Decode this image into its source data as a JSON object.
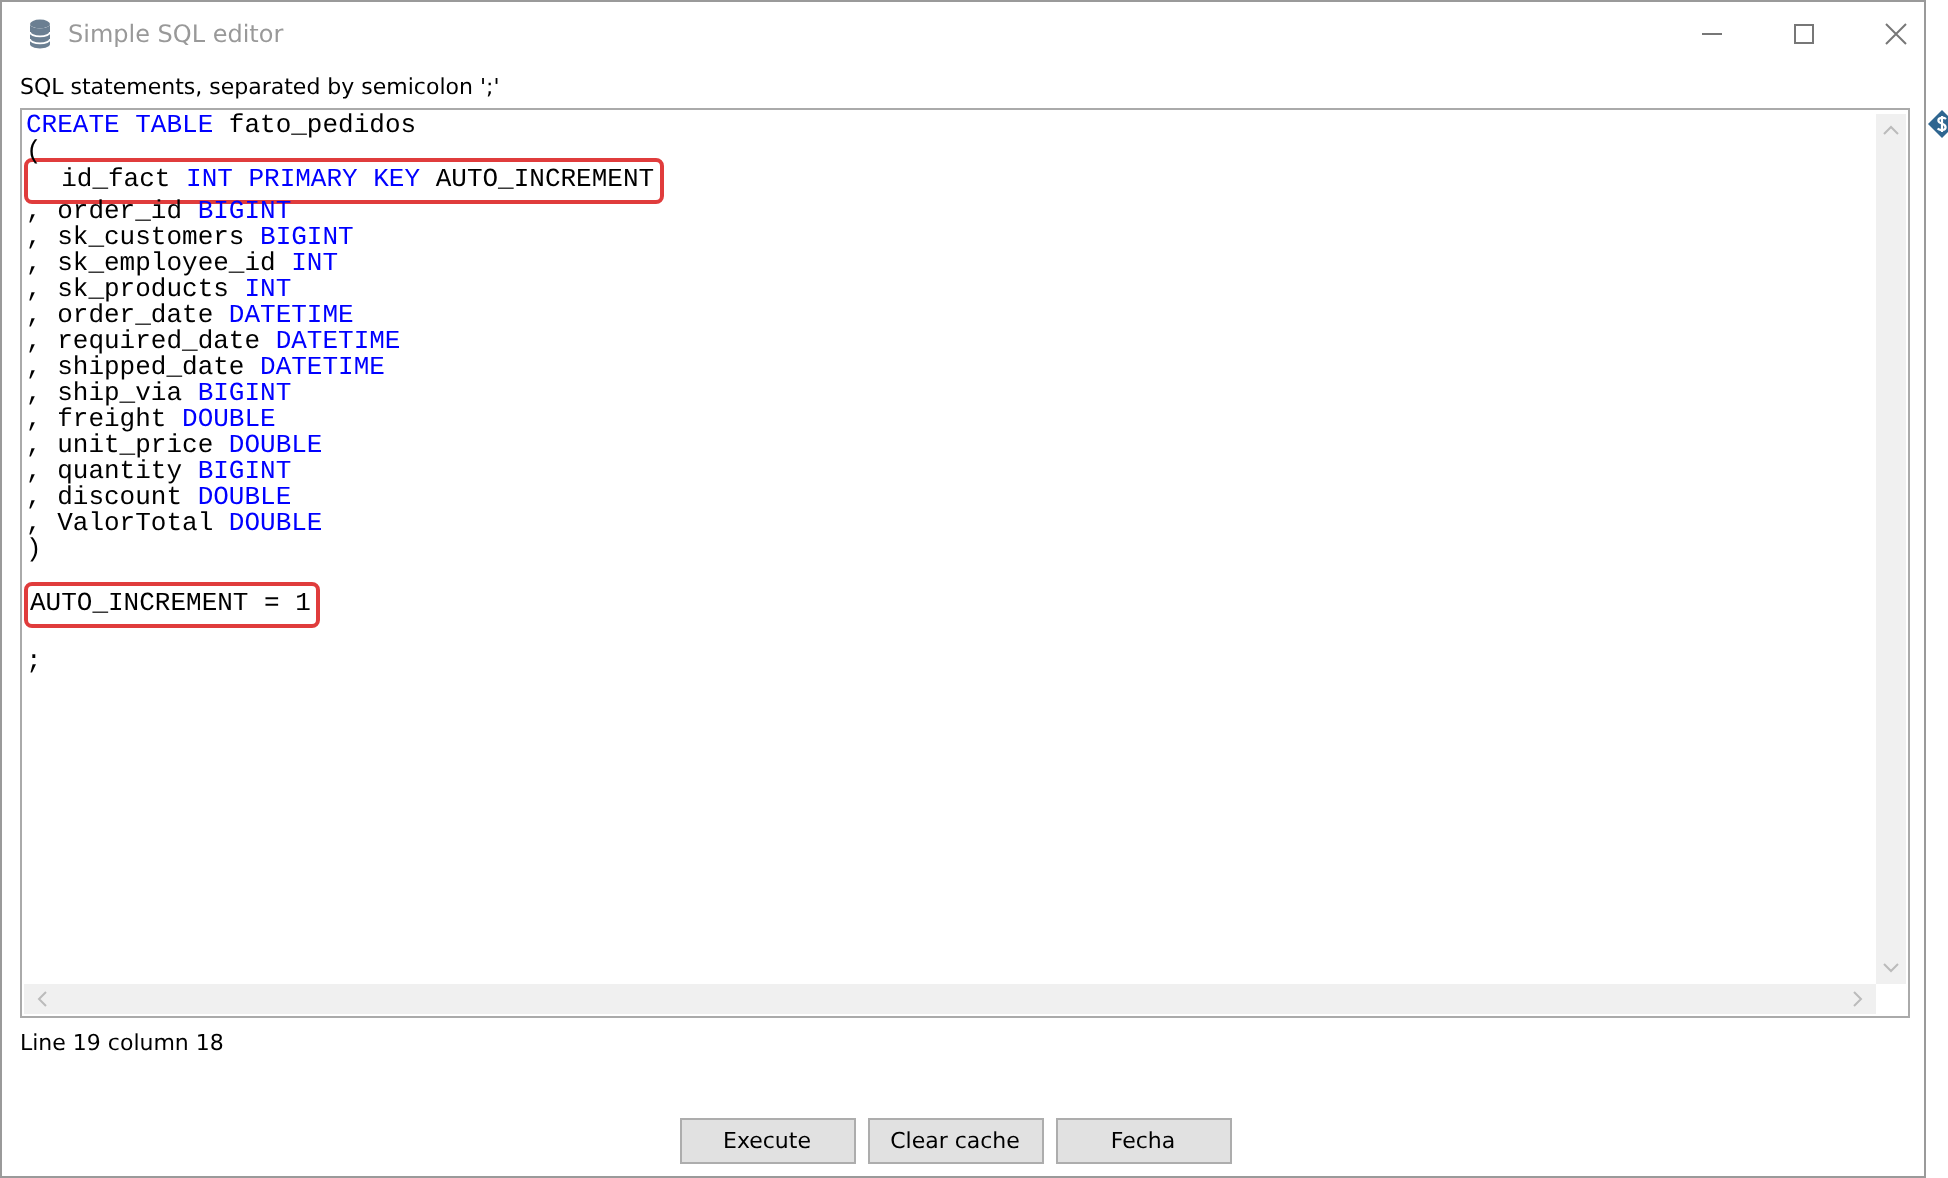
{
  "window": {
    "title": "Simple SQL editor"
  },
  "prompt": "SQL statements, separated by semicolon ';'",
  "editor": {
    "lines": [
      {
        "tokens": [
          {
            "text": "CREATE TABLE",
            "kind": "keyword"
          },
          {
            "text": " fato_pedidos",
            "kind": "plain"
          }
        ],
        "highlighted": false
      },
      {
        "tokens": [
          {
            "text": "(",
            "kind": "plain"
          }
        ],
        "highlighted": false
      },
      {
        "tokens": [
          {
            "text": "  id_fact ",
            "kind": "plain"
          },
          {
            "text": "INT PRIMARY KEY",
            "kind": "keyword"
          },
          {
            "text": " AUTO_INCREMENT",
            "kind": "plain"
          }
        ],
        "highlighted": true
      },
      {
        "tokens": [
          {
            "text": ", order_id ",
            "kind": "plain"
          },
          {
            "text": "BIGINT",
            "kind": "keyword"
          }
        ],
        "highlighted": false
      },
      {
        "tokens": [
          {
            "text": ", sk_customers ",
            "kind": "plain"
          },
          {
            "text": "BIGINT",
            "kind": "keyword"
          }
        ],
        "highlighted": false
      },
      {
        "tokens": [
          {
            "text": ", sk_employee_id ",
            "kind": "plain"
          },
          {
            "text": "INT",
            "kind": "keyword"
          }
        ],
        "highlighted": false
      },
      {
        "tokens": [
          {
            "text": ", sk_products ",
            "kind": "plain"
          },
          {
            "text": "INT",
            "kind": "keyword"
          }
        ],
        "highlighted": false
      },
      {
        "tokens": [
          {
            "text": ", order_date ",
            "kind": "plain"
          },
          {
            "text": "DATETIME",
            "kind": "keyword"
          }
        ],
        "highlighted": false
      },
      {
        "tokens": [
          {
            "text": ", required_date ",
            "kind": "plain"
          },
          {
            "text": "DATETIME",
            "kind": "keyword"
          }
        ],
        "highlighted": false
      },
      {
        "tokens": [
          {
            "text": ", shipped_date ",
            "kind": "plain"
          },
          {
            "text": "DATETIME",
            "kind": "keyword"
          }
        ],
        "highlighted": false
      },
      {
        "tokens": [
          {
            "text": ", ship_via ",
            "kind": "plain"
          },
          {
            "text": "BIGINT",
            "kind": "keyword"
          }
        ],
        "highlighted": false
      },
      {
        "tokens": [
          {
            "text": ", freight ",
            "kind": "plain"
          },
          {
            "text": "DOUBLE",
            "kind": "keyword"
          }
        ],
        "highlighted": false
      },
      {
        "tokens": [
          {
            "text": ", unit_price ",
            "kind": "plain"
          },
          {
            "text": "DOUBLE",
            "kind": "keyword"
          }
        ],
        "highlighted": false
      },
      {
        "tokens": [
          {
            "text": ", quantity ",
            "kind": "plain"
          },
          {
            "text": "BIGINT",
            "kind": "keyword"
          }
        ],
        "highlighted": false
      },
      {
        "tokens": [
          {
            "text": ", discount ",
            "kind": "plain"
          },
          {
            "text": "DOUBLE",
            "kind": "keyword"
          }
        ],
        "highlighted": false
      },
      {
        "tokens": [
          {
            "text": ", ValorTotal ",
            "kind": "plain"
          },
          {
            "text": "DOUBLE",
            "kind": "keyword"
          }
        ],
        "highlighted": false
      },
      {
        "tokens": [
          {
            "text": ")",
            "kind": "plain"
          }
        ],
        "highlighted": false
      },
      {
        "highlighted": false
      },
      {
        "tokens": [
          {
            "text": "AUTO_INCREMENT = 1",
            "kind": "plain"
          }
        ],
        "highlighted": true
      },
      {
        "highlighted": false
      },
      {
        "tokens": [
          {
            "text": ";",
            "kind": "plain"
          }
        ],
        "highlighted": false
      }
    ]
  },
  "status": "Line 19 column 18",
  "buttons": [
    "Execute",
    "Clear cache",
    "Fecha"
  ]
}
